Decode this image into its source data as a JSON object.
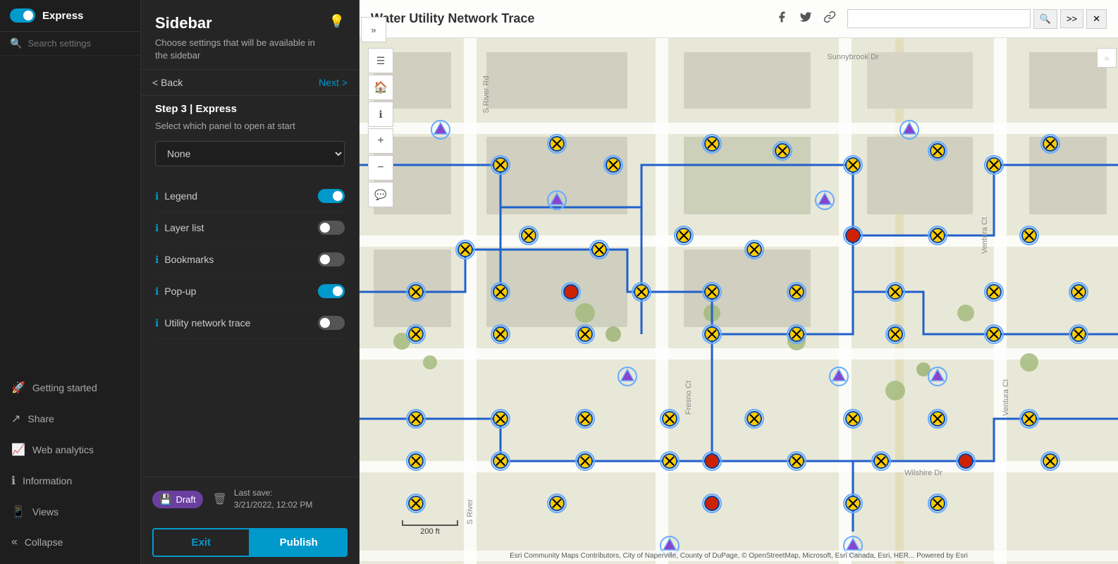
{
  "app": {
    "toggle_state": "on",
    "title": "Express"
  },
  "search": {
    "placeholder": "Search settings"
  },
  "panel": {
    "title": "Sidebar",
    "subtitle": "Choose settings that will be available in the sidebar",
    "hint_icon": "💡"
  },
  "navigation": {
    "back_label": "< Back",
    "next_label": "Next >"
  },
  "step": {
    "label": "Step 3 | Express",
    "description": "Select which panel to open at start"
  },
  "start_panel": {
    "options": [
      "None",
      "Legend",
      "Layer list",
      "Bookmarks",
      "Pop-up",
      "Utility network trace"
    ],
    "selected": "None"
  },
  "toggles": [
    {
      "label": "Legend",
      "state": "on"
    },
    {
      "label": "Layer list",
      "state": "off"
    },
    {
      "label": "Bookmarks",
      "state": "off"
    },
    {
      "label": "Pop-up",
      "state": "on"
    },
    {
      "label": "Utility network trace",
      "state": "off"
    }
  ],
  "footer": {
    "draft_label": "Draft",
    "last_save": "Last save:",
    "save_date": "3/21/2022, 12:02 PM"
  },
  "actions": {
    "exit_label": "Exit",
    "publish_label": "Publish"
  },
  "left_nav": {
    "search_placeholder": "Search settings",
    "items": [
      {
        "id": "getting-started",
        "label": "Getting started",
        "icon": "🚀"
      },
      {
        "id": "share",
        "label": "Share",
        "icon": "↗"
      },
      {
        "id": "web-analytics",
        "label": "Web analytics",
        "icon": "📈"
      },
      {
        "id": "information",
        "label": "Information",
        "icon": "ℹ"
      },
      {
        "id": "views",
        "label": "Views",
        "icon": "📱"
      },
      {
        "id": "collapse",
        "label": "Collapse",
        "icon": "«"
      }
    ]
  },
  "map": {
    "title": "Water Utility Network Trace",
    "search_placeholder": "",
    "attribution": "Esri Community Maps Contributors, City of Naperville, County of DuPage, © OpenStreetMap, Microsoft, Esri Canada, Esri, HER... Powered by Esri",
    "scale": "200 ft"
  }
}
